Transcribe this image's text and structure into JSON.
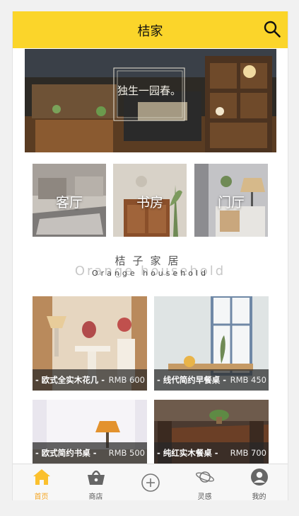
{
  "header": {
    "title": "桔家",
    "search_icon": "search-icon"
  },
  "banner": {
    "image": "storefront-shelves-photo",
    "signage": "独生一园春。",
    "active_slide": 1
  },
  "categories": [
    {
      "label": "客厅"
    },
    {
      "label": "书房"
    },
    {
      "label": "门厅"
    }
  ],
  "brand": {
    "cn": "桔子家居",
    "ghost": "Orange household",
    "en": "Orange household"
  },
  "products": [
    {
      "name": "- 欧式全实木花几 -",
      "price": "RMB 600"
    },
    {
      "name": "- 线代简约早餐桌 -",
      "price": "RMB 450"
    },
    {
      "name": "- 欧式简约书桌 -",
      "price": "RMB 500"
    },
    {
      "name": "- 纯红实木餐桌 -",
      "price": "RMB 700"
    }
  ],
  "tabs": [
    {
      "label": "首页",
      "icon": "home-icon",
      "active": true
    },
    {
      "label": "商店",
      "icon": "basket-icon",
      "active": false
    },
    {
      "label": "",
      "icon": "add-circle-icon",
      "active": false
    },
    {
      "label": "灵感",
      "icon": "planet-icon",
      "active": false
    },
    {
      "label": "我的",
      "icon": "user-icon",
      "active": false
    }
  ],
  "colors": {
    "accent": "#fbd52a",
    "active_tab": "#f5a623",
    "slide_dot": "#1a7fe5"
  }
}
